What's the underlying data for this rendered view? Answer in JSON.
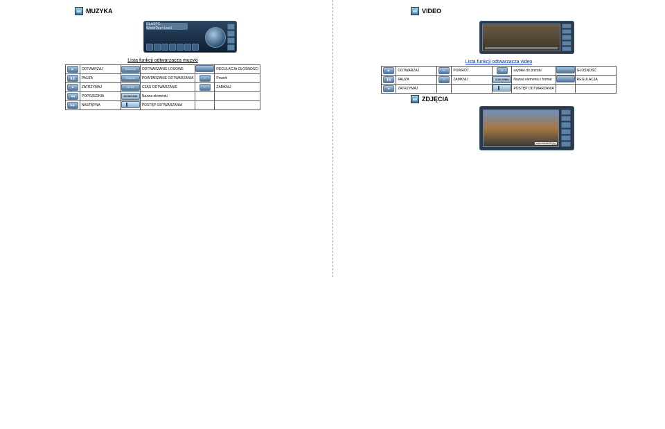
{
  "left": {
    "title": "MUZYKA",
    "lcd": "GLASPC: WorldTour~Live1",
    "subhead": "Lista funkcji odtwarzacza muzyki",
    "table": [
      [
        {
          "t": "icon",
          "v": "play"
        },
        "ODTWARZAJ",
        {
          "t": "chip",
          "v": "Random"
        },
        "ODTWARZANIE LOSOWE",
        {
          "t": "chip",
          "v": ""
        },
        "REGULACJA GŁOŚNOŚCI"
      ],
      [
        {
          "t": "icon",
          "v": "pause"
        },
        "PAUZA",
        {
          "t": "chip",
          "v": "Repeat"
        },
        "POWTARZANIE ODTWARZANIA",
        {
          "t": "chip-sm",
          "v": "↩"
        },
        "Powrót"
      ],
      [
        {
          "t": "icon",
          "v": "stop"
        },
        "ZATRZYMAJ",
        {
          "t": "chip",
          "v": "01:45"
        },
        "CZAS ODTWARZANIE",
        {
          "t": "chip-sm",
          "v": "↵"
        },
        "ZAMKNIJ"
      ],
      [
        {
          "t": "icon",
          "v": "prev"
        },
        "POPRZEDNIA",
        {
          "t": "chip-lbl",
          "v": "NOWO346"
        },
        "Nazwa elementu",
        "",
        ""
      ],
      [
        {
          "t": "icon",
          "v": "next"
        },
        "NASTĘPNA",
        {
          "t": "chip-prog",
          "v": ""
        },
        "POSTĘP ODTWARZANIA",
        "",
        ""
      ]
    ]
  },
  "right": {
    "title": "VIDEO",
    "subhead": "Lista funkcji odtwarzacza video",
    "table": [
      [
        {
          "t": "icon",
          "v": "play"
        },
        "ODTWARZAJ",
        {
          "t": "chip-sm",
          "v": "↩"
        },
        "POWRÓT",
        {
          "t": "chip-sm",
          "v": "≫"
        },
        "szybkie do przodu",
        {
          "t": "chip",
          "v": ""
        },
        "GŁOŚNOŚĆ"
      ],
      [
        {
          "t": "icon",
          "v": "pause"
        },
        "PAUZA",
        {
          "t": "chip-sm",
          "v": "↵"
        },
        "ZAMKNIJ",
        {
          "t": "chip-lbl",
          "v": "3.2M WMV"
        },
        "Nazwa elementu i format",
        {
          "t": "chip",
          "v": ""
        },
        "REGULACJA"
      ],
      [
        {
          "t": "icon",
          "v": "stop"
        },
        "ZATRZYMAJ",
        "",
        "",
        {
          "t": "chip-prog",
          "v": ""
        },
        "POSTĘP ODTWARZANIA",
        "",
        ""
      ]
    ],
    "zdj_title": "ZDJĘCIA",
    "zdj_cap": "zdjecia\\auto02.jpg"
  }
}
